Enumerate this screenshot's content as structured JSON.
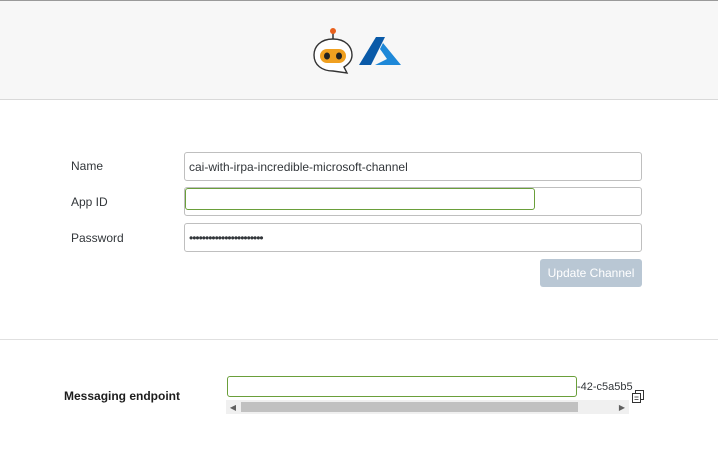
{
  "header": {
    "bot_logo": "sap-cai-bot-logo",
    "azure_logo": "microsoft-azure-logo"
  },
  "form": {
    "name_label": "Name",
    "name_value": "cai-with-irpa-incredible-microsoft-channel",
    "appid_label": "App ID",
    "appid_value": "",
    "password_label": "Password",
    "password_value": "•••••••••••••••••••••••",
    "update_button": "Update Channel"
  },
  "endpoint": {
    "label": "Messaging endpoint",
    "visible_text": "-42-c5a5b5"
  },
  "colors": {
    "focus_border": "#6a9f3a",
    "button_disabled": "#b9c7d4",
    "bot_orange": "#f0a020",
    "azure_blue": "#0078d4"
  }
}
